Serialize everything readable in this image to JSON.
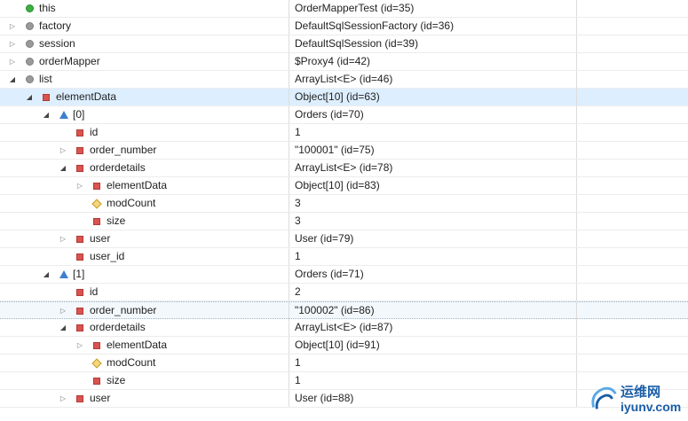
{
  "rows": [
    {
      "name": "this",
      "value": "OrderMapperTest  (id=35)",
      "depth": 0,
      "toggle": "none",
      "icon": "green"
    },
    {
      "name": "factory",
      "value": "DefaultSqlSessionFactory  (id=36)",
      "depth": 0,
      "toggle": "collapsed",
      "icon": "gray"
    },
    {
      "name": "session",
      "value": "DefaultSqlSession  (id=39)",
      "depth": 0,
      "toggle": "collapsed",
      "icon": "gray"
    },
    {
      "name": "orderMapper",
      "value": "$Proxy4  (id=42)",
      "depth": 0,
      "toggle": "collapsed",
      "icon": "gray"
    },
    {
      "name": "list",
      "value": "ArrayList<E>  (id=46)",
      "depth": 0,
      "toggle": "expanded",
      "icon": "gray"
    },
    {
      "name": "elementData",
      "value": "Object[10]  (id=63)",
      "depth": 1,
      "toggle": "expanded",
      "icon": "red",
      "selected": true
    },
    {
      "name": "[0]",
      "value": "Orders  (id=70)",
      "depth": 2,
      "toggle": "expanded",
      "icon": "triangle"
    },
    {
      "name": "id",
      "value": "1",
      "depth": 3,
      "toggle": "none",
      "icon": "red"
    },
    {
      "name": "order_number",
      "value": "\"100001\" (id=75)",
      "depth": 3,
      "toggle": "collapsed",
      "icon": "red"
    },
    {
      "name": "orderdetails",
      "value": "ArrayList<E>  (id=78)",
      "depth": 3,
      "toggle": "expanded",
      "icon": "red"
    },
    {
      "name": "elementData",
      "value": "Object[10]  (id=83)",
      "depth": 4,
      "toggle": "collapsed",
      "icon": "red"
    },
    {
      "name": "modCount",
      "value": "3",
      "depth": 4,
      "toggle": "none",
      "icon": "diamond"
    },
    {
      "name": "size",
      "value": "3",
      "depth": 4,
      "toggle": "none",
      "icon": "red"
    },
    {
      "name": "user",
      "value": "User  (id=79)",
      "depth": 3,
      "toggle": "collapsed",
      "icon": "red"
    },
    {
      "name": "user_id",
      "value": "1",
      "depth": 3,
      "toggle": "none",
      "icon": "red"
    },
    {
      "name": "[1]",
      "value": "Orders  (id=71)",
      "depth": 2,
      "toggle": "expanded",
      "icon": "triangle"
    },
    {
      "name": "id",
      "value": "2",
      "depth": 3,
      "toggle": "none",
      "icon": "red"
    },
    {
      "name": "order_number",
      "value": "\"100002\" (id=86)",
      "depth": 3,
      "toggle": "collapsed",
      "icon": "red",
      "highlight": true
    },
    {
      "name": "orderdetails",
      "value": "ArrayList<E>  (id=87)",
      "depth": 3,
      "toggle": "expanded",
      "icon": "red"
    },
    {
      "name": "elementData",
      "value": "Object[10]  (id=91)",
      "depth": 4,
      "toggle": "collapsed",
      "icon": "red"
    },
    {
      "name": "modCount",
      "value": "1",
      "depth": 4,
      "toggle": "none",
      "icon": "diamond"
    },
    {
      "name": "size",
      "value": "1",
      "depth": 4,
      "toggle": "none",
      "icon": "red"
    },
    {
      "name": "user",
      "value": "User  (id=88)",
      "depth": 3,
      "toggle": "collapsed",
      "icon": "red"
    }
  ],
  "watermark": {
    "title": "运维网",
    "subtitle": "iyunv.com"
  }
}
